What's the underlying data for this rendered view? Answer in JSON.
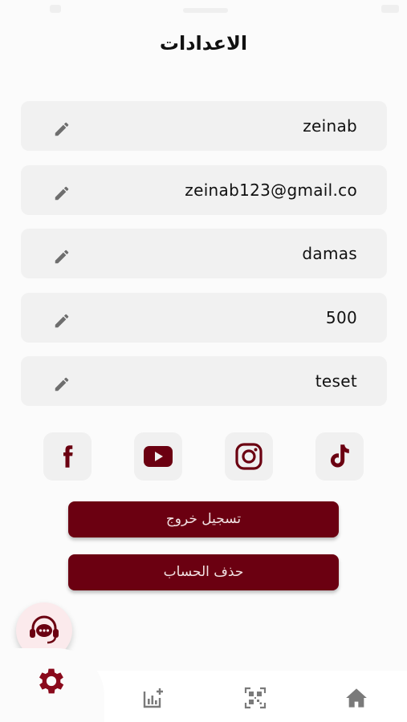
{
  "header": {
    "title": "الاعدادات"
  },
  "fields": [
    {
      "value": "zeinab"
    },
    {
      "value": "zeinab123@gmail.co"
    },
    {
      "value": "damas"
    },
    {
      "value": "500"
    },
    {
      "value": "teset"
    }
  ],
  "social": {
    "items": [
      "facebook-icon",
      "youtube-icon",
      "instagram-icon",
      "tiktok-icon"
    ]
  },
  "actions": {
    "logout_label": "تسجيل خروج",
    "delete_account_label": "حذف الحساب"
  },
  "nav": {
    "items": [
      "settings-icon",
      "add-chart-icon",
      "qr-code-icon",
      "home-icon"
    ]
  },
  "colors": {
    "brand": "#6b0011",
    "field_bg": "#f1f1f1",
    "page_bg": "#fbfbfb"
  }
}
